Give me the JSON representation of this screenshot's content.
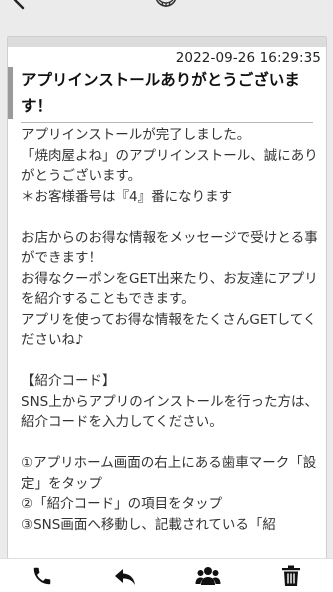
{
  "header": {
    "back_icon": "back-arrow-icon",
    "logo_icon": "brand-logo-icon"
  },
  "message": {
    "timestamp": "2022-09-26 16:29:35",
    "title": "アプリインストールありがとうございます！",
    "body": "アプリインストールが完了しました。\n「焼肉屋よね」のアプリインストール、誠にありがとうございます。\n＊お客様番号は『4』番になります\n\nお店からのお得な情報をメッセージで受けとる事ができます！\nお得なクーポンをGET出来たり、お友達にアプリを紹介することもできます。\nアプリを使ってお得な情報をたくさんGETしてくださいね♪\n\n【紹介コード】\nSNS上からアプリのインストールを行った方は、紹介コードを入力してください。\n\n①アプリホーム画面の右上にある歯車マーク「設定」をタップ\n②「紹介コード」の項目をタップ\n③SNS画面へ移動し、記載されている「紹"
  },
  "bottom_nav": {
    "items": [
      {
        "icon": "phone-icon"
      },
      {
        "icon": "reply-icon"
      },
      {
        "icon": "group-icon"
      },
      {
        "icon": "trash-icon"
      }
    ]
  },
  "colors": {
    "background": "#ebebeb",
    "card": "#ffffff",
    "accent_bar": "#9a9a9a",
    "icon": "#111111"
  }
}
